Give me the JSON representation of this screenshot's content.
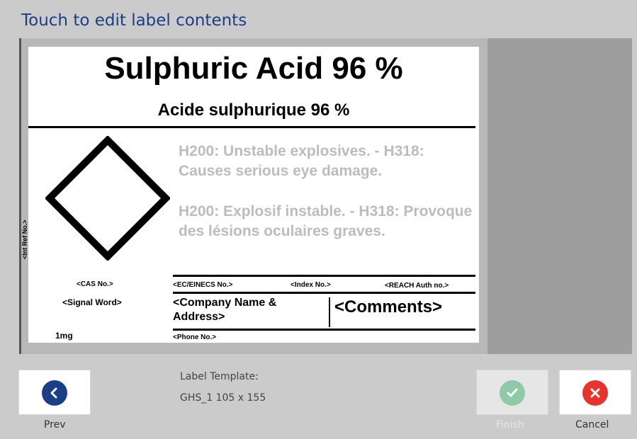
{
  "header": {
    "title": "Touch to edit label contents"
  },
  "label": {
    "title": "Sulphuric Acid 96 %",
    "subtitle": "Acide sulphurique 96 %",
    "int_ref": "<Int Ref No.>",
    "hazard_en": "H200: Unstable explosives. - H318: Causes serious eye damage.",
    "hazard_fr": "H200: Explosif instable. - H318: Provoque des lésions oculaires graves.",
    "cas": "<CAS No.>",
    "ec": "<EC/EINECS No.>",
    "index": "<Index No.>",
    "reach": "<REACH Auth no.>",
    "signal_word": "<Signal Word>",
    "company": "<Company Name & Address>",
    "comments": "<Comments>",
    "quantity": "1mg",
    "phone": "<Phone No.>"
  },
  "footer": {
    "prev_label": "Prev",
    "template_heading": "Label Template:",
    "template_name": "GHS_1 105 x 155",
    "finish_label": "Finish",
    "cancel_label": "Cancel"
  },
  "colors": {
    "title": "#1a3f86",
    "prev_button": "#1a3f86",
    "finish_button_disabled": "#8fcaa8",
    "cancel_button": "#e8322b",
    "hazard_text": "#bcbcbc"
  },
  "icons": {
    "prev": "chevron-left-icon",
    "finish": "check-icon",
    "cancel": "close-icon",
    "hazard_pictogram": "ghs-diamond"
  }
}
